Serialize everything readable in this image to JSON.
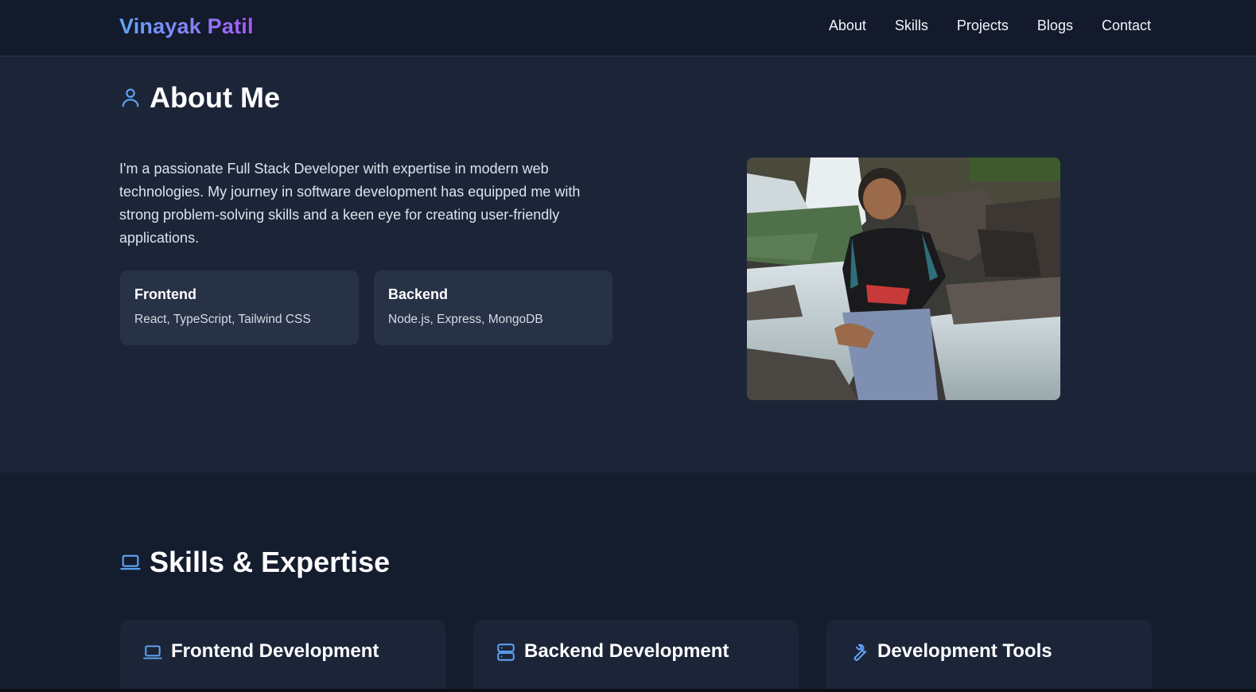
{
  "nav": {
    "brand": "Vinayak Patil",
    "links": [
      "About",
      "Skills",
      "Projects",
      "Blogs",
      "Contact"
    ]
  },
  "about": {
    "title": "About Me",
    "icon": "user-icon",
    "text": "I'm a passionate Full Stack Developer with expertise in modern web technologies. My journey in software development has equipped me with strong problem-solving skills and a keen eye for creating user-friendly applications.",
    "cards": [
      {
        "title": "Frontend",
        "desc": "React, TypeScript, Tailwind CSS"
      },
      {
        "title": "Backend",
        "desc": "Node.js, Express, MongoDB"
      }
    ],
    "photo_icon": "profile-photo"
  },
  "skills": {
    "title": "Skills & Expertise",
    "icon": "laptop-icon",
    "cards": [
      {
        "title": "Frontend Development",
        "icon": "laptop-icon"
      },
      {
        "title": "Backend Development",
        "icon": "server-icon"
      },
      {
        "title": "Development Tools",
        "icon": "wrench-icon"
      }
    ]
  },
  "colors": {
    "accent": "#60a5fa",
    "brand_gradient_end": "#a855f7",
    "background": "#1c2538",
    "card": "#273246"
  }
}
